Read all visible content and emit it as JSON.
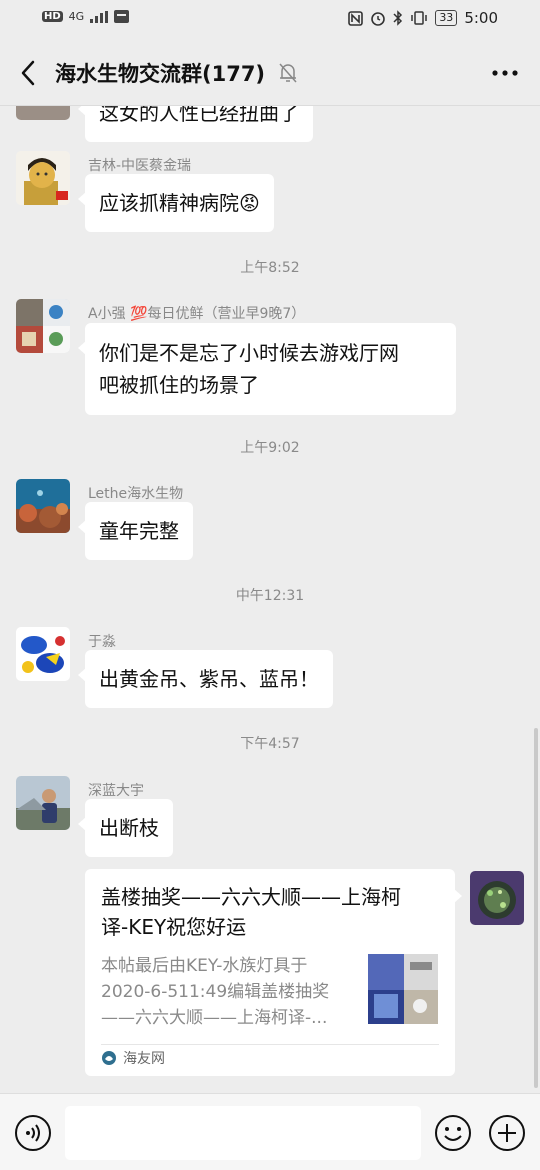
{
  "status_bar": {
    "network": "4G",
    "battery": "33",
    "time": "5:00"
  },
  "header": {
    "title": "海水生物交流群(177)"
  },
  "messages": [
    {
      "text": "这女的人性已经扭曲了"
    },
    {
      "sender": "吉林-中医蔡金瑞",
      "text": "应该抓精神病院😡"
    },
    {
      "time": "上午8:52"
    },
    {
      "sender": "A小强 💯每日优鲜（营业早9晚7）",
      "text_line1": "你们是不是忘了小时候去游戏厅网",
      "text_line2": "吧被抓住的场景了"
    },
    {
      "time": "上午9:02"
    },
    {
      "sender": "Lethe海水生物",
      "text": "童年完整"
    },
    {
      "time": "中午12:31"
    },
    {
      "sender": "于淼",
      "text": "出黄金吊、紫吊、蓝吊！"
    },
    {
      "time": "下午4:57"
    },
    {
      "sender": "深蓝大宇",
      "text": "出断枝"
    }
  ],
  "link_card": {
    "title_line1": "盖楼抽奖——六六大顺——上海柯",
    "title_line2": "译-KEY祝您好运",
    "desc_line1": "本帖最后由KEY-水族灯具于",
    "desc_line2": "2020-6-511:49编辑盖楼抽奖",
    "desc_line3": "——六六大顺——上海柯译-...",
    "source": "海友网"
  },
  "colors": {
    "background": "#ededed",
    "bubble": "#ffffff",
    "meta_text": "#8a8a8a"
  },
  "icons": [
    "back-arrow-icon",
    "mute-bell-icon",
    "more-icon",
    "voice-icon",
    "emoji-icon",
    "plus-icon"
  ]
}
